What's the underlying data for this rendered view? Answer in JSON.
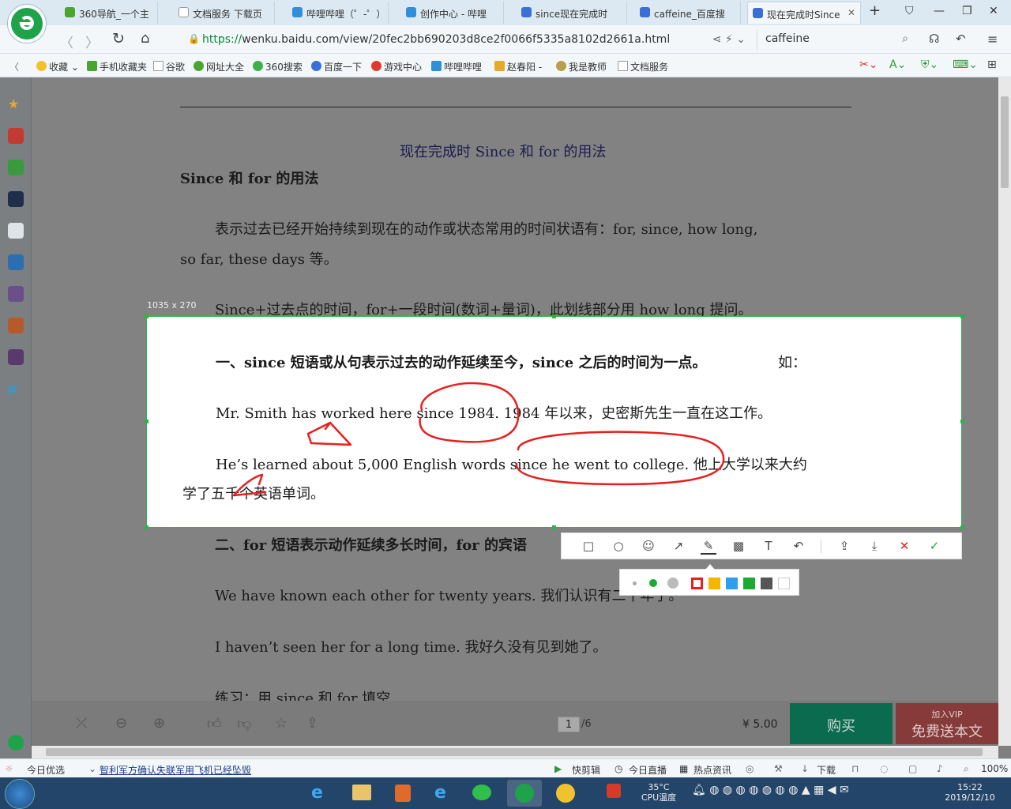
{
  "browser": {
    "tabs": [
      {
        "label": "360导航_一个主",
        "color": "#4aa52e"
      },
      {
        "label": "文档服务 下载页",
        "color": "#999999"
      },
      {
        "label": "哔哩哔哩（゜-゜）",
        "color": "#2f8fd8"
      },
      {
        "label": "创作中心 - 哔哩",
        "color": "#2f8fd8"
      },
      {
        "label": "since现在完成时",
        "color": "#3a6fd8"
      },
      {
        "label": "caffeine_百度搜",
        "color": "#3a6fd8"
      },
      {
        "label": "现在完成时Since",
        "color": "#3a6fd8"
      }
    ],
    "url_protocol": "https://",
    "url_rest": "wenku.baidu.com/view/20fec2bb690203d8ce2f0066f5335a8102d2661a.html",
    "search_value": "caffeine",
    "bookmarks": [
      "收藏",
      "手机收藏夹",
      "谷歌",
      "网址大全",
      "360搜索",
      "百度一下",
      "游戏中心",
      "哔哩哔哩",
      "赵春阳 -",
      "我是教师",
      "文档服务"
    ]
  },
  "document": {
    "title": "现在完成时 Since 和 for 的用法",
    "heading": "Since  和  for  的用法",
    "para1_l1": "表示过去已经开始持续到现在的动作或状态常用的时间状语有：for,  since,  how  long,",
    "para1_l2": "so  far,  these  days 等。",
    "para2": "Since+过去点的时间，for+一段时间(数词+量词)，此划线部分用 how  long 提问。",
    "rule1": "一、since 短语或从句表示过去的动作延续至今，since 之后的时间为一点。",
    "rule1_suffix": "如：",
    "ex1": "Mr.  Smith  has  worked  here  since  1984.  1984 年以来，史密斯先生一直在这工作。",
    "ex2_l1": "He’s  learned  about  5,000  English  words  since  he  went  to  college.  他上大学以来大约",
    "ex2_l2": "学了五千个英语单词。",
    "rule2": "二、for 短语表示动作延续多长时间，for 的宾语",
    "ex3": "We  have  known  each  other  for  twenty  years.  我们认识有二十年了。",
    "ex4": "I  haven’t  seen  her  for  a  long  time.  我好久没有见到她了。",
    "ex5": "练习：用 since 和 for 填空"
  },
  "screenshot_tool": {
    "dimensions_label": "1035 x 270",
    "tools": [
      "rectangle-tool",
      "ellipse-tool",
      "mosaic-tool",
      "arrow-tool",
      "pen-tool",
      "blur-tool",
      "text-tool",
      "undo-tool",
      "share-tool",
      "save-tool",
      "cancel-tool",
      "confirm-tool"
    ],
    "colors": [
      "#e62020",
      "#f7b500",
      "#2e9ff0",
      "#1caa33",
      "#555555",
      "#ffffff"
    ],
    "annotation_color": "#e62020"
  },
  "reader": {
    "page_current": "1",
    "page_total": "/6",
    "price": "¥ 5.00",
    "buy_label": "购买",
    "vip_top": "加入VIP",
    "vip_bottom": "免费送本文"
  },
  "statusbar": {
    "left1": "今日优选",
    "news": "智利军方确认失联军用飞机已经坠毁",
    "items": [
      "快剪辑",
      "今日直播",
      "热点资讯",
      "下载"
    ],
    "zoom": "100%"
  },
  "taskbar": {
    "temp": "35°C",
    "temp_label": "CPU温度",
    "time": "15:22",
    "date": "2019/12/10"
  }
}
